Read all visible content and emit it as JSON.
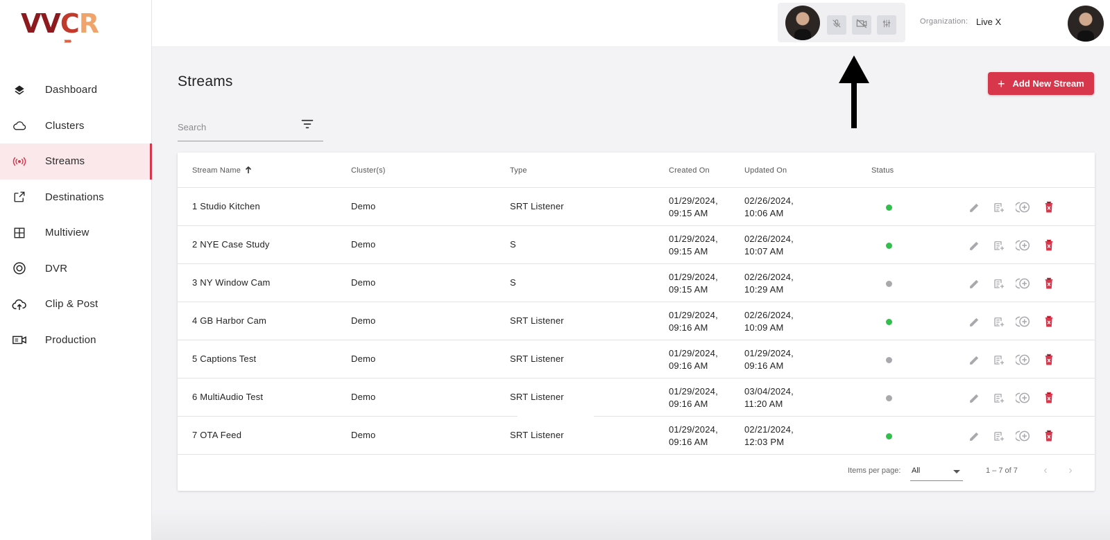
{
  "brand": {
    "logo_text_1": "VV",
    "logo_text_2": "C",
    "logo_text_3": "R"
  },
  "sidebar": {
    "items": [
      {
        "label": "Dashboard",
        "icon": "layers-icon",
        "active": false
      },
      {
        "label": "Clusters",
        "icon": "cloud-icon",
        "active": false
      },
      {
        "label": "Streams",
        "icon": "broadcast-icon",
        "active": true
      },
      {
        "label": "Destinations",
        "icon": "external-link-icon",
        "active": false
      },
      {
        "label": "Multiview",
        "icon": "grid-icon",
        "active": false
      },
      {
        "label": "DVR",
        "icon": "record-icon",
        "active": false
      },
      {
        "label": "Clip & Post",
        "icon": "cloud-upload-icon",
        "active": false
      },
      {
        "label": "Production",
        "icon": "video-camera-icon",
        "active": false
      }
    ]
  },
  "topbar": {
    "call_controls": [
      "mic-off-icon",
      "video-off-icon",
      "sliders-icon"
    ],
    "org_label": "Organization:",
    "org_value": "Live X"
  },
  "main": {
    "title": "Streams",
    "add_button": "Add New Stream",
    "search_placeholder": "Search"
  },
  "table": {
    "headers": {
      "name": "Stream Name",
      "clusters": "Cluster(s)",
      "type": "Type",
      "created": "Created On",
      "updated": "Updated On",
      "status": "Status"
    },
    "sort_icon": "arrow-up-icon",
    "rows": [
      {
        "name": "1 Studio Kitchen",
        "cluster": "Demo",
        "type": "SRT Listener",
        "created_date": "01/29/2024,",
        "created_time": "09:15 AM",
        "updated_date": "02/26/2024,",
        "updated_time": "10:06 AM",
        "status": "active"
      },
      {
        "name": "2 NYE Case Study",
        "cluster": "Demo",
        "type": "S",
        "created_date": "01/29/2024,",
        "created_time": "09:15 AM",
        "updated_date": "02/26/2024,",
        "updated_time": "10:07 AM",
        "status": "active"
      },
      {
        "name": "3 NY Window Cam",
        "cluster": "Demo",
        "type": "S",
        "created_date": "01/29/2024,",
        "created_time": "09:15 AM",
        "updated_date": "02/26/2024,",
        "updated_time": "10:29 AM",
        "status": "inactive"
      },
      {
        "name": "4 GB Harbor Cam",
        "cluster": "Demo",
        "type": "SRT Listener",
        "created_date": "01/29/2024,",
        "created_time": "09:16 AM",
        "updated_date": "02/26/2024,",
        "updated_time": "10:09 AM",
        "status": "active"
      },
      {
        "name": "5 Captions Test",
        "cluster": "Demo",
        "type": "SRT Listener",
        "created_date": "01/29/2024,",
        "created_time": "09:16 AM",
        "updated_date": "01/29/2024,",
        "updated_time": "09:16 AM",
        "status": "inactive"
      },
      {
        "name": "6 MultiAudio Test",
        "cluster": "Demo",
        "type": "SRT Listener",
        "created_date": "01/29/2024,",
        "created_time": "09:16 AM",
        "updated_date": "03/04/2024,",
        "updated_time": "11:20 AM",
        "status": "inactive"
      },
      {
        "name": "7 OTA Feed",
        "cluster": "Demo",
        "type": "SRT Listener",
        "created_date": "01/29/2024,",
        "created_time": "09:16 AM",
        "updated_date": "02/21/2024,",
        "updated_time": "12:03 PM",
        "status": "active"
      }
    ],
    "row_actions": [
      "edit-icon",
      "add-note-icon",
      "add-circle-icon",
      "delete-icon"
    ]
  },
  "pagination": {
    "items_per_page_label": "Items per page:",
    "items_per_page_value": "All",
    "range": "1 – 7 of 7"
  },
  "colors": {
    "accent": "#d7364b",
    "status_active": "#2fbf4a",
    "status_inactive": "#a9a9ad",
    "sidebar_active_bg": "#fbe8ea"
  }
}
